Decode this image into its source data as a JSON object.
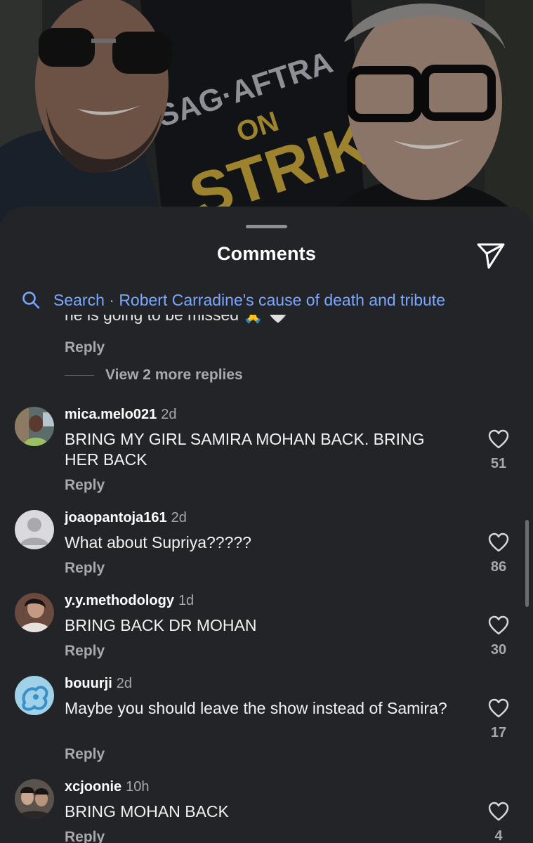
{
  "sheet": {
    "title": "Comments",
    "search_text": "Search · Robert Carradine's cause of death and tribute",
    "partial_text": "he is going to be missed 🙏 🤍",
    "reply_label": "Reply",
    "view_more_label": "View 2 more replies"
  },
  "photo": {
    "sign_lines": [
      "SAG·AFTRA",
      "ON",
      "STRIKE"
    ]
  },
  "comments": [
    {
      "username": "mica.melo021",
      "time": "2d",
      "text": "BRING MY GIRL SAMIRA MOHAN BACK. BRING HER BACK",
      "likes": "51",
      "reply": "Reply"
    },
    {
      "username": "joaopantoja161",
      "time": "2d",
      "text": "What about Supriya?????",
      "likes": "86",
      "reply": "Reply"
    },
    {
      "username": "y.y.methodology",
      "time": "1d",
      "text": "BRING BACK DR MOHAN",
      "likes": "30",
      "reply": "Reply"
    },
    {
      "username": "bouurji",
      "time": "2d",
      "text": "Maybe you should leave the show instead of Samira?",
      "likes": "17",
      "reply": "Reply"
    },
    {
      "username": "xcjoonie",
      "time": "10h",
      "text": "BRING MOHAN BACK",
      "likes": "4",
      "reply": "Reply"
    }
  ],
  "colors": {
    "sheet_bg": "#232428",
    "search_link": "#7aa7ff",
    "muted": "#a8a8ad"
  }
}
